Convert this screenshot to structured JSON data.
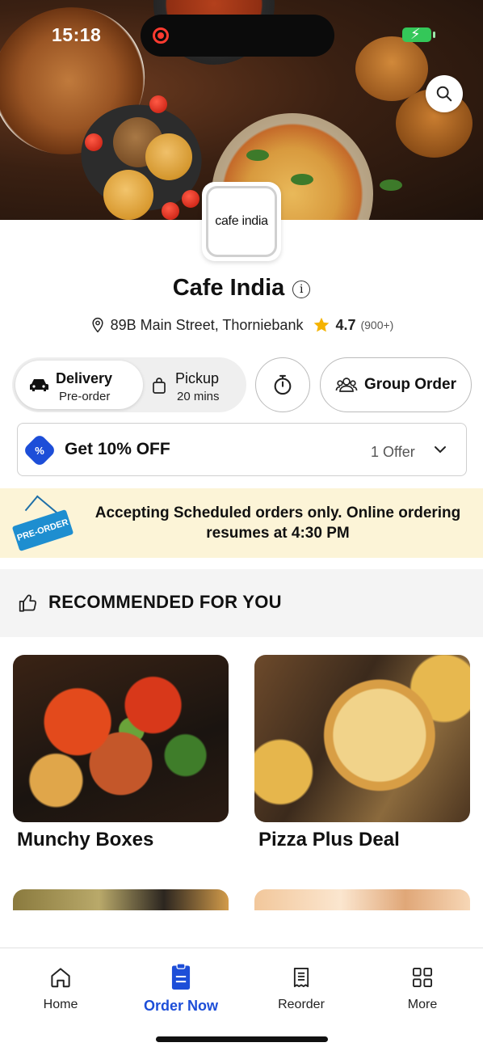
{
  "status_bar": {
    "time": "15:18"
  },
  "restaurant": {
    "logo_text": "cafe india",
    "name": "Cafe India",
    "address": "89B Main Street, Thorniebank",
    "rating": "4.7",
    "rating_count": "(900+)"
  },
  "order_mode": {
    "delivery_label": "Delivery",
    "delivery_sub": "Pre-order",
    "pickup_label": "Pickup",
    "pickup_sub": "20 mins",
    "group_order_label": "Group Order"
  },
  "offer": {
    "badge_symbol": "%",
    "title": "Get 10% OFF",
    "count": "1 Offer"
  },
  "notice": {
    "tag": "PRE-ORDER",
    "text": "Accepting Scheduled orders only. Online ordering resumes at 4:30 PM"
  },
  "section": {
    "title": "RECOMMENDED FOR YOU"
  },
  "recommended": [
    {
      "name": "Munchy Boxes"
    },
    {
      "name": "Pizza Plus Deal"
    }
  ],
  "nav": {
    "items": [
      {
        "label": "Home",
        "icon": "home-icon"
      },
      {
        "label": "Order Now",
        "icon": "order-icon",
        "active": true
      },
      {
        "label": "Reorder",
        "icon": "receipt-icon"
      },
      {
        "label": "More",
        "icon": "grid-icon"
      }
    ]
  },
  "colors": {
    "accent": "#1d4ed8",
    "banner_bg": "#fcf4d7",
    "star": "#f5b301"
  }
}
